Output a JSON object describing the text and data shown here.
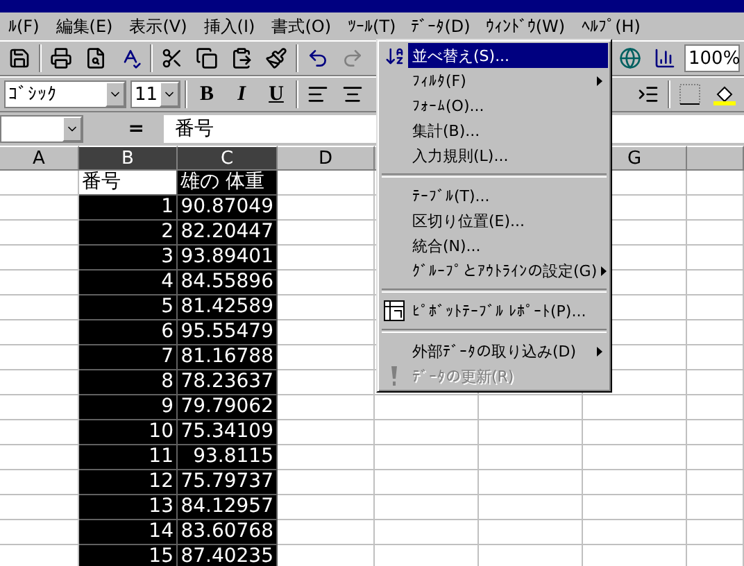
{
  "menu_bar": [
    {
      "label": "ﾙ(F)",
      "selected": false
    },
    {
      "label": "編集(E)",
      "selected": false
    },
    {
      "label": "表示(V)",
      "selected": false
    },
    {
      "label": "挿入(I)",
      "selected": false
    },
    {
      "label": "書式(O)",
      "selected": false
    },
    {
      "label": "ﾂｰﾙ(T)",
      "selected": false
    },
    {
      "label": "ﾃﾞｰﾀ(D)",
      "selected": true
    },
    {
      "label": "ｳｨﾝﾄﾞｳ(W)",
      "selected": false
    },
    {
      "label": "ﾍﾙﾌﾟ(H)",
      "selected": false
    }
  ],
  "standard_toolbar": {
    "zoom": "100%"
  },
  "format_toolbar": {
    "font": "ｺﾞｼｯｸ",
    "size": "11",
    "bold": "B",
    "italic": "I",
    "underline": "U"
  },
  "formula_bar": {
    "equals": "=",
    "content": "番号"
  },
  "columns": [
    {
      "label": "A",
      "selected": false
    },
    {
      "label": "B",
      "selected": true
    },
    {
      "label": "C",
      "selected": true
    },
    {
      "label": "D",
      "selected": false
    },
    {
      "label": "G",
      "selected": false
    }
  ],
  "rows": [
    {
      "b": "番号",
      "c": "雄の 体重",
      "header": true
    },
    {
      "b": "1",
      "c": "90.87049"
    },
    {
      "b": "2",
      "c": "82.20447"
    },
    {
      "b": "3",
      "c": "93.89401"
    },
    {
      "b": "4",
      "c": "84.55896"
    },
    {
      "b": "5",
      "c": "81.42589"
    },
    {
      "b": "6",
      "c": "95.55479"
    },
    {
      "b": "7",
      "c": "81.16788"
    },
    {
      "b": "8",
      "c": "78.23637"
    },
    {
      "b": "9",
      "c": "79.79062"
    },
    {
      "b": "10",
      "c": "75.34109"
    },
    {
      "b": "11",
      "c": "93.8115"
    },
    {
      "b": "12",
      "c": "75.79737"
    },
    {
      "b": "13",
      "c": "84.12957"
    },
    {
      "b": "14",
      "c": "83.60768"
    },
    {
      "b": "15",
      "c": "87.40235"
    }
  ],
  "data_menu": [
    {
      "kind": "item",
      "label": "並べ替え(S)...",
      "selected": true,
      "submenu": false,
      "disabled": false
    },
    {
      "kind": "item",
      "label": "ﾌｨﾙﾀ(F)",
      "selected": false,
      "submenu": true,
      "disabled": false
    },
    {
      "kind": "item",
      "label": "ﾌｫｰﾑ(O)...",
      "selected": false,
      "submenu": false,
      "disabled": false
    },
    {
      "kind": "item",
      "label": "集計(B)...",
      "selected": false,
      "submenu": false,
      "disabled": false
    },
    {
      "kind": "item",
      "label": "入力規則(L)...",
      "selected": false,
      "submenu": false,
      "disabled": false
    },
    {
      "kind": "separator"
    },
    {
      "kind": "item",
      "label": "ﾃｰﾌﾞﾙ(T)...",
      "selected": false,
      "submenu": false,
      "disabled": false
    },
    {
      "kind": "item",
      "label": "区切り位置(E)...",
      "selected": false,
      "submenu": false,
      "disabled": false
    },
    {
      "kind": "item",
      "label": "統合(N)...",
      "selected": false,
      "submenu": false,
      "disabled": false
    },
    {
      "kind": "item",
      "label": "ｸﾞﾙｰﾌﾟとｱｳﾄﾗｲﾝの設定(G)",
      "selected": false,
      "submenu": true,
      "disabled": false
    },
    {
      "kind": "separator"
    },
    {
      "kind": "item",
      "label": "ﾋﾟﾎﾞｯﾄﾃｰﾌﾞﾙ ﾚﾎﾟｰﾄ(P)...",
      "selected": false,
      "submenu": false,
      "disabled": false
    },
    {
      "kind": "separator"
    },
    {
      "kind": "item",
      "label": "外部ﾃﾞｰﾀの取り込み(D)",
      "selected": false,
      "submenu": true,
      "disabled": false
    },
    {
      "kind": "item",
      "label": "ﾃﾞｰﾀの更新(R)",
      "selected": false,
      "submenu": false,
      "disabled": true
    }
  ]
}
